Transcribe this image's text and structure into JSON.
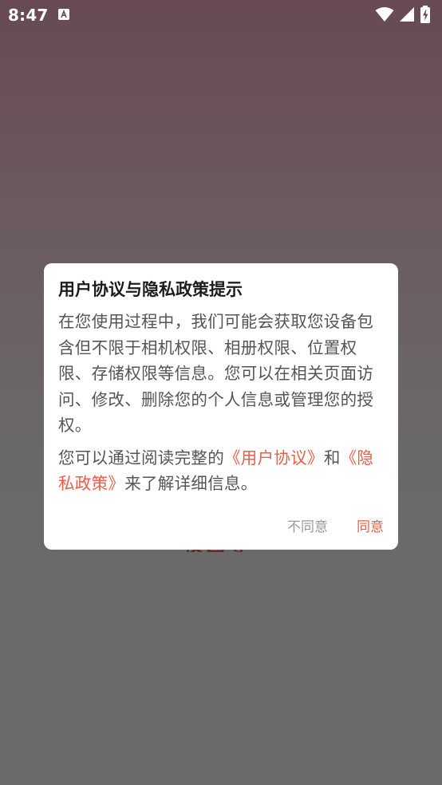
{
  "status_bar": {
    "time": "8:47",
    "app_icon": "font-a-icon",
    "icons": [
      "wifi-icon",
      "signal-icon",
      "battery-charging-icon"
    ]
  },
  "background": {
    "peek_text": "校园导航"
  },
  "dialog": {
    "title": "用户协议与隐私政策提示",
    "paragraph1": "在您使用过程中，我们可能会获取您设备包含但不限于相机权限、相册权限、位置权限、存储权限等信息。您可以在相关页面访问、修改、删除您的个人信息或管理您的授权。",
    "p2_prefix": "您可以通过阅读完整的",
    "user_agreement_link": "《用户协议》",
    "p2_and": "和",
    "privacy_policy_link": "《隐私政策》",
    "p2_suffix": "来了解详细信息。",
    "decline_label": "不同意",
    "accept_label": "同意"
  },
  "colors": {
    "accent": "#ee5d47",
    "decline": "#9a9a9a",
    "body_text": "#555555"
  }
}
